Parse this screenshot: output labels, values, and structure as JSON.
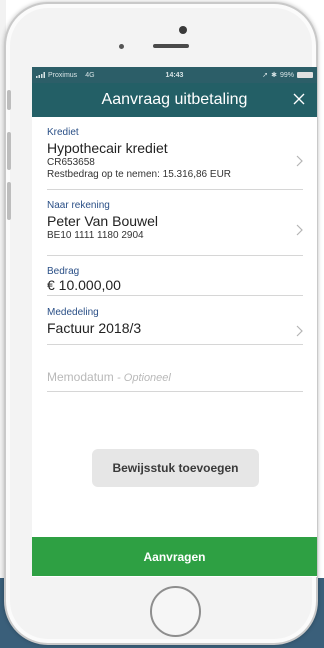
{
  "status_bar": {
    "carrier": "Proximus",
    "network": "4G",
    "time": "14:43",
    "battery": "99%"
  },
  "header": {
    "title": "Aanvraag uitbetaling",
    "close_icon": "close-icon"
  },
  "form": {
    "credit": {
      "label": "Krediet",
      "name": "Hypothecair krediet",
      "reference": "CR653658",
      "remaining": "Restbedrag op te nemen: 15.316,86 EUR"
    },
    "to_account": {
      "label": "Naar rekening",
      "name": "Peter Van Bouwel",
      "iban": "BE10 1111 1180 2904"
    },
    "amount": {
      "label": "Bedrag",
      "value": "€ 10.000,00"
    },
    "message": {
      "label": "Mededeling",
      "value": "Factuur 2018/3"
    },
    "memo_date": {
      "placeholder": "Memodatum",
      "optional": "- Optioneel"
    }
  },
  "buttons": {
    "attach": "Bewijsstuk toevoegen",
    "submit": "Aanvragen"
  },
  "colors": {
    "header": "#235f66",
    "status_bar": "#2c5e68",
    "label": "#2a4f86",
    "submit": "#2ea043"
  }
}
